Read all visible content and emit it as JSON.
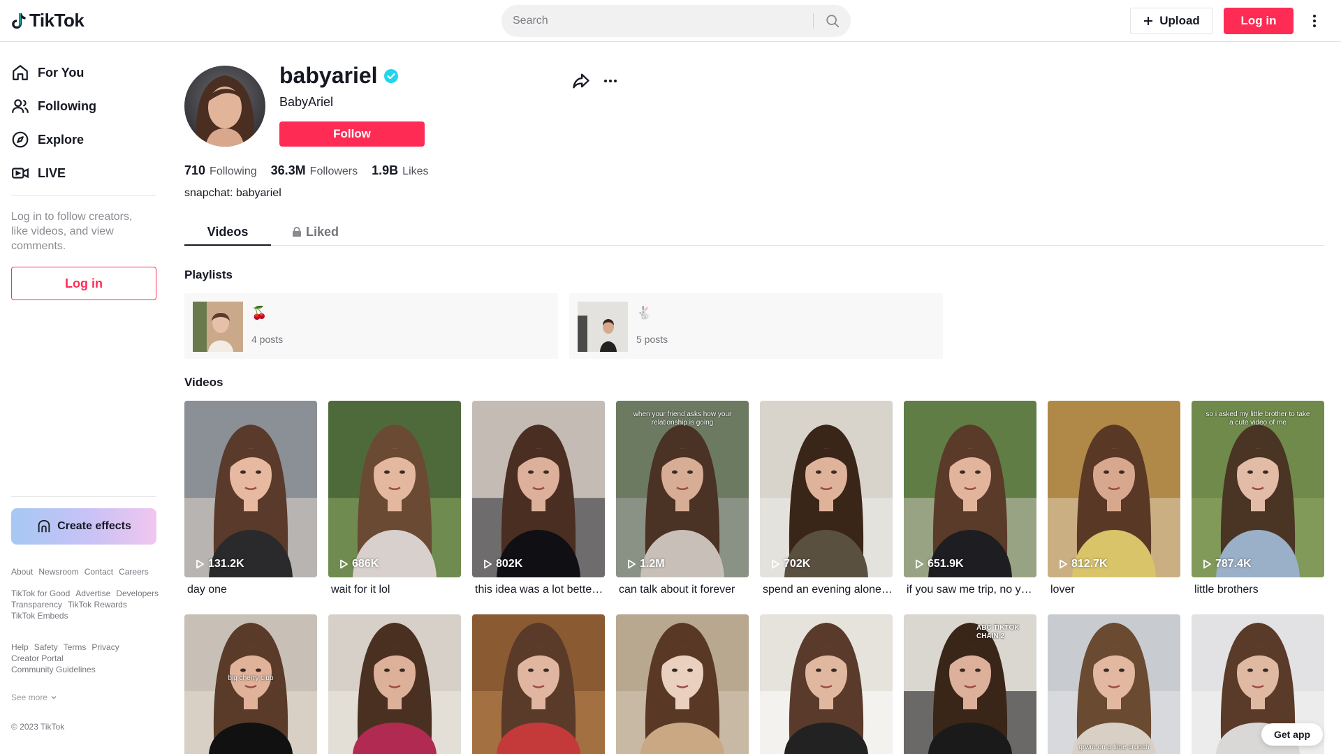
{
  "header": {
    "logo_text": "TikTok",
    "search_placeholder": "Search",
    "upload_label": "Upload",
    "login_label": "Log in"
  },
  "sidebar": {
    "nav": [
      {
        "label": "For You",
        "icon": "home-icon"
      },
      {
        "label": "Following",
        "icon": "people-icon"
      },
      {
        "label": "Explore",
        "icon": "compass-icon"
      },
      {
        "label": "LIVE",
        "icon": "live-icon"
      }
    ],
    "login_prompt": "Log in to follow creators, like videos, and view comments.",
    "login_label": "Log in",
    "effects_label": "Create effects",
    "footer_group1": [
      "About",
      "Newsroom",
      "Contact",
      "Careers"
    ],
    "footer_group2": [
      "TikTok for Good",
      "Advertise",
      "Developers",
      "Transparency",
      "TikTok Rewards",
      "TikTok Embeds"
    ],
    "footer_group3": [
      "Help",
      "Safety",
      "Terms",
      "Privacy",
      "Creator Portal",
      "Community Guidelines"
    ],
    "see_more": "See more",
    "copyright": "© 2023 TikTok"
  },
  "profile": {
    "username": "babyariel",
    "nickname": "BabyAriel",
    "verified": true,
    "follow_label": "Follow",
    "stats": [
      {
        "value": "710",
        "label": "Following"
      },
      {
        "value": "36.3M",
        "label": "Followers"
      },
      {
        "value": "1.9B",
        "label": "Likes"
      }
    ],
    "bio": "snapchat: babyariel"
  },
  "tabs": [
    {
      "label": "Videos",
      "active": true
    },
    {
      "label": "Liked",
      "locked": true
    }
  ],
  "playlists_title": "Playlists",
  "playlists": [
    {
      "name": "🍒",
      "count": "4 posts"
    },
    {
      "name": "🐇",
      "count": "5 posts"
    }
  ],
  "videos_title": "Videos",
  "videos_row1": [
    {
      "views": "131.2K",
      "title": "day one"
    },
    {
      "views": "686K",
      "title": "wait for it lol"
    },
    {
      "views": "802K",
      "title": "this idea was a lot better in my head"
    },
    {
      "views": "1.2M",
      "title": "can talk about it forever",
      "caption": "when your friend asks how your relationship is going"
    },
    {
      "views": "702K",
      "title": "spend an evening alone with me"
    },
    {
      "views": "651.9K",
      "title": "if you saw me trip, no you didn't"
    },
    {
      "views": "812.7K",
      "title": "lover"
    },
    {
      "views": "787.4K",
      "title": "little brothers",
      "caption": "so i asked my little brother to take a cute video of me"
    }
  ],
  "videos_row2": [
    {
      "caption": "big cherry club"
    },
    {
      "caption": ""
    },
    {
      "caption": ""
    },
    {
      "caption": ""
    },
    {
      "caption": ""
    },
    {
      "caption": "ABC TIKTOK CHAIN 2"
    },
    {
      "caption": "grwm on a time crunch"
    },
    {
      "caption": ""
    }
  ],
  "get_app_label": "Get app",
  "colors": {
    "accent": "#fe2c55",
    "verified": "#20d5ec",
    "text": "#161823"
  }
}
